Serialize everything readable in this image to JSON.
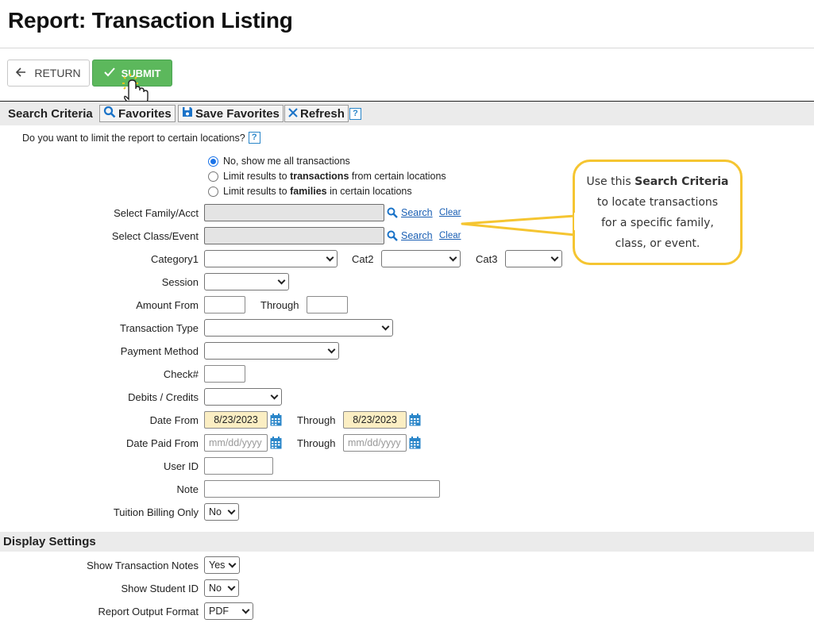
{
  "page": {
    "title": "Report: Transaction Listing"
  },
  "toolbar": {
    "return_label": "RETURN",
    "submit_label": "SUBMIT"
  },
  "search_criteria": {
    "title": "Search Criteria",
    "favorites_label": "Favorites",
    "save_favorites_label": "Save Favorites",
    "refresh_label": "Refresh",
    "help_glyph": "?"
  },
  "locations": {
    "question": "Do you want to limit the report to certain locations?",
    "options": [
      {
        "pre": "No, show me all transactions",
        "bold": "",
        "post": "",
        "selected": true
      },
      {
        "pre": "Limit results to ",
        "bold": "transactions",
        "post": " from certain locations",
        "selected": false
      },
      {
        "pre": "Limit results to ",
        "bold": "families",
        "post": " in certain locations",
        "selected": false
      }
    ]
  },
  "fields": {
    "family": {
      "label": "Select Family/Acct",
      "search": "Search",
      "clear": "Clear"
    },
    "class_event": {
      "label": "Select Class/Event",
      "search": "Search",
      "clear": "Clear"
    },
    "category1": {
      "label": "Category1",
      "value": ""
    },
    "cat2": {
      "label": "Cat2",
      "value": ""
    },
    "cat3": {
      "label": "Cat3",
      "value": ""
    },
    "session": {
      "label": "Session",
      "value": ""
    },
    "amount_from": {
      "label": "Amount From",
      "value": ""
    },
    "amount_through": {
      "label": "Through",
      "value": ""
    },
    "transaction_type": {
      "label": "Transaction Type",
      "value": ""
    },
    "payment_method": {
      "label": "Payment Method",
      "value": ""
    },
    "check_no": {
      "label": "Check#",
      "value": ""
    },
    "debits_credits": {
      "label": "Debits / Credits",
      "value": ""
    },
    "date_from": {
      "label": "Date From",
      "value": "8/23/2023"
    },
    "date_through": {
      "label": "Through",
      "value": "8/23/2023"
    },
    "date_paid_from": {
      "label": "Date Paid From",
      "placeholder": "mm/dd/yyyy"
    },
    "date_paid_through": {
      "label": "Through",
      "placeholder": "mm/dd/yyyy"
    },
    "user_id": {
      "label": "User ID",
      "value": ""
    },
    "note": {
      "label": "Note",
      "value": ""
    },
    "tuition_billing_only": {
      "label": "Tuition Billing Only",
      "value": "No"
    }
  },
  "callout": {
    "line1_pre": "Use this ",
    "line1_bold": "Search Criteria",
    "line2": "to locate transactions",
    "line3": "for a specific family,",
    "line4": "class, or event.",
    "border_color": "#f5c531"
  },
  "display_settings": {
    "title": "Display Settings",
    "show_transaction_notes": {
      "label": "Show Transaction Notes",
      "value": "Yes"
    },
    "show_student_id": {
      "label": "Show Student ID",
      "value": "No"
    },
    "report_output_format": {
      "label": "Report Output Format",
      "value": "PDF"
    }
  },
  "colors": {
    "submit_green": "#5cb85c",
    "date_highlight": "#fbeec3",
    "link_blue": "#1a5fb4",
    "help_blue": "#2a86c9"
  }
}
